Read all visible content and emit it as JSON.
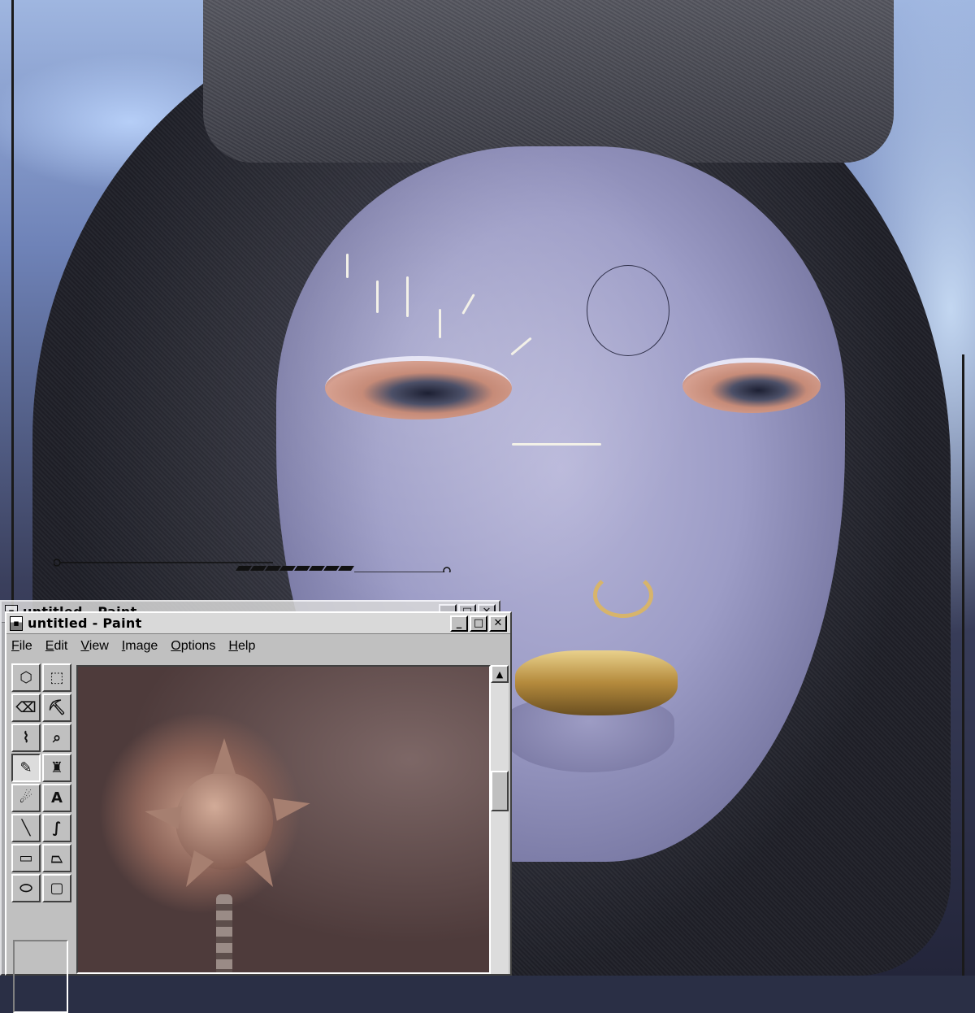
{
  "background": {
    "description_icons": [
      "moon-icon",
      "rocket-icon",
      "snake-icon",
      "mace-icon"
    ]
  },
  "paint_back": {
    "title": "untitled - Paint"
  },
  "paint": {
    "title": "untitled - Paint",
    "controls": {
      "minimize": "_",
      "maximize": "□",
      "close": "✕"
    },
    "menu": [
      {
        "underlined": "F",
        "rest": "ile"
      },
      {
        "underlined": "E",
        "rest": "dit"
      },
      {
        "underlined": "V",
        "rest": "iew"
      },
      {
        "underlined": "I",
        "rest": "mage"
      },
      {
        "underlined": "O",
        "rest": "ptions"
      },
      {
        "underlined": "H",
        "rest": "elp"
      }
    ],
    "tools": [
      {
        "name": "free-select-icon",
        "glyph": "⬡"
      },
      {
        "name": "rect-select-icon",
        "glyph": "⬚"
      },
      {
        "name": "eraser-icon",
        "glyph": "⌫"
      },
      {
        "name": "fill-icon",
        "glyph": "⛏"
      },
      {
        "name": "picker-icon",
        "glyph": "⌇"
      },
      {
        "name": "magnifier-icon",
        "glyph": "⌕"
      },
      {
        "name": "pencil-icon",
        "glyph": "✎"
      },
      {
        "name": "brush-icon",
        "glyph": "♜"
      },
      {
        "name": "airbrush-icon",
        "glyph": "☄"
      },
      {
        "name": "text-icon",
        "glyph": "A"
      },
      {
        "name": "line-icon",
        "glyph": "╲"
      },
      {
        "name": "curve-icon",
        "glyph": "∫"
      },
      {
        "name": "rectangle-icon",
        "glyph": "▭"
      },
      {
        "name": "polygon-icon",
        "glyph": "⏢"
      },
      {
        "name": "ellipse-icon",
        "glyph": "⬭"
      },
      {
        "name": "rounded-rect-icon",
        "glyph": "▢"
      }
    ],
    "active_tool": 6,
    "scroll": {
      "up": "▲",
      "down": "▼"
    }
  },
  "colors": {
    "window_face": "#c0c0c0",
    "ring_gold": "#d7b46b",
    "skin": "#9c9cc6"
  }
}
